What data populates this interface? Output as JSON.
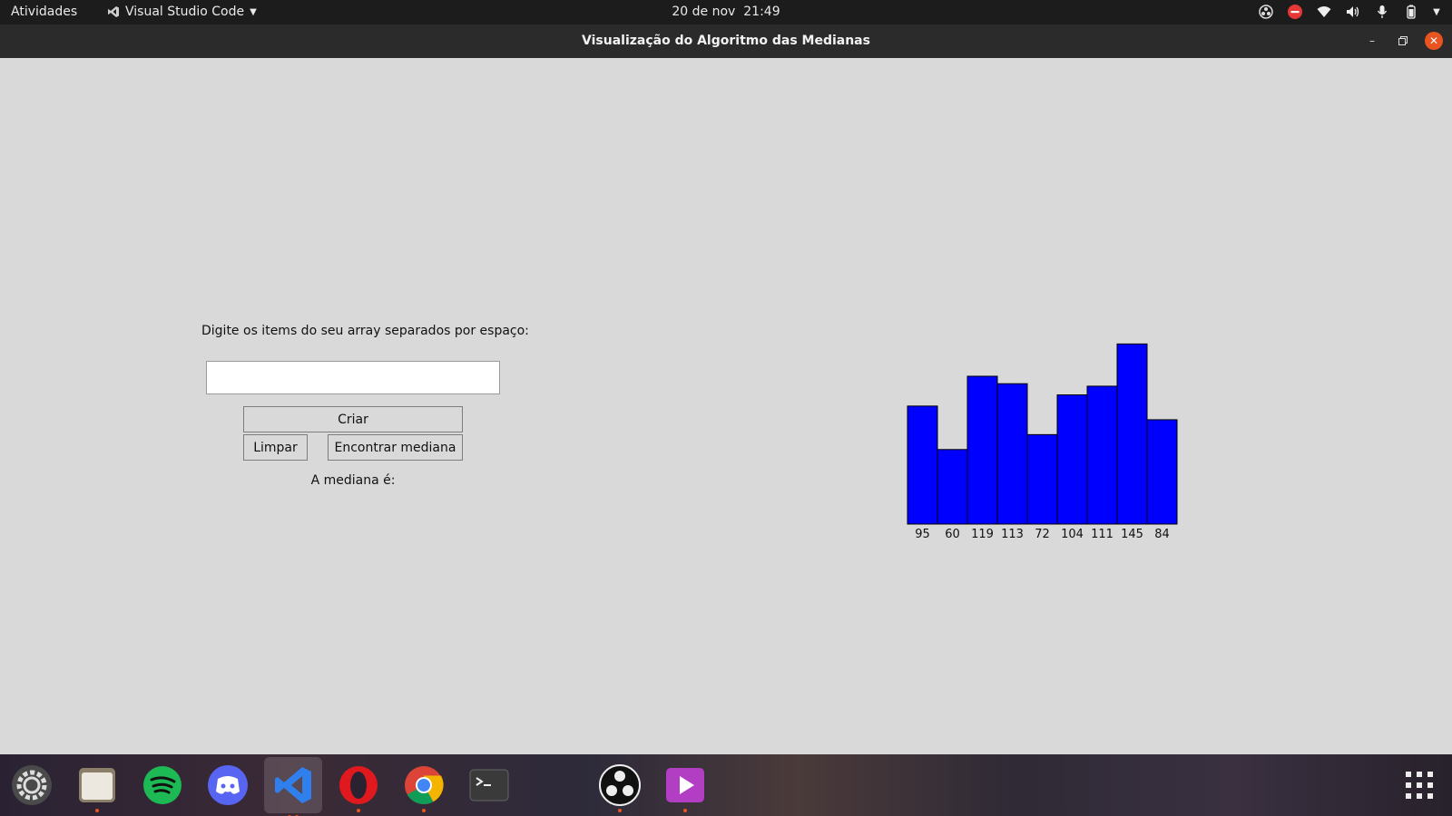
{
  "topbar": {
    "activities": "Atividades",
    "app_name": "Visual Studio Code",
    "date": "20 de nov",
    "time": "21:49"
  },
  "window": {
    "title": "Visualização do Algoritmo das Medianas"
  },
  "form": {
    "prompt": "Digite os items do seu array separados por espaço:",
    "input_value": "",
    "create_label": "Criar",
    "clear_label": "Limpar",
    "find_median_label": "Encontrar mediana",
    "result_label": "A mediana é:"
  },
  "chart_data": {
    "type": "bar",
    "categories": [
      "95",
      "60",
      "119",
      "113",
      "72",
      "104",
      "111",
      "145",
      "84"
    ],
    "values": [
      95,
      60,
      119,
      113,
      72,
      104,
      111,
      145,
      84
    ],
    "bar_color": "#0000ff",
    "title": "",
    "xlabel": "",
    "ylabel": ""
  },
  "dock": {
    "items": [
      {
        "icon": "settings-icon",
        "color": "#4a4a4a",
        "running": false
      },
      {
        "icon": "files-icon",
        "color": "#c9b99a",
        "running": true
      },
      {
        "icon": "spotify-icon",
        "color": "#1db954",
        "running": false
      },
      {
        "icon": "discord-icon",
        "color": "#5865f2",
        "running": false
      },
      {
        "icon": "vscode-icon",
        "color": "#2f80ed",
        "running": true
      },
      {
        "icon": "opera-icon",
        "color": "#e0191f",
        "running": true
      },
      {
        "icon": "chrome-icon",
        "color": "#4285f4",
        "running": true
      },
      {
        "icon": "terminal-icon",
        "color": "#3a3a3a",
        "running": false
      },
      {
        "icon": "obs-icon",
        "color": "#111111",
        "running": true
      },
      {
        "icon": "video-player-icon",
        "color": "#b23ec4",
        "running": true
      }
    ]
  }
}
